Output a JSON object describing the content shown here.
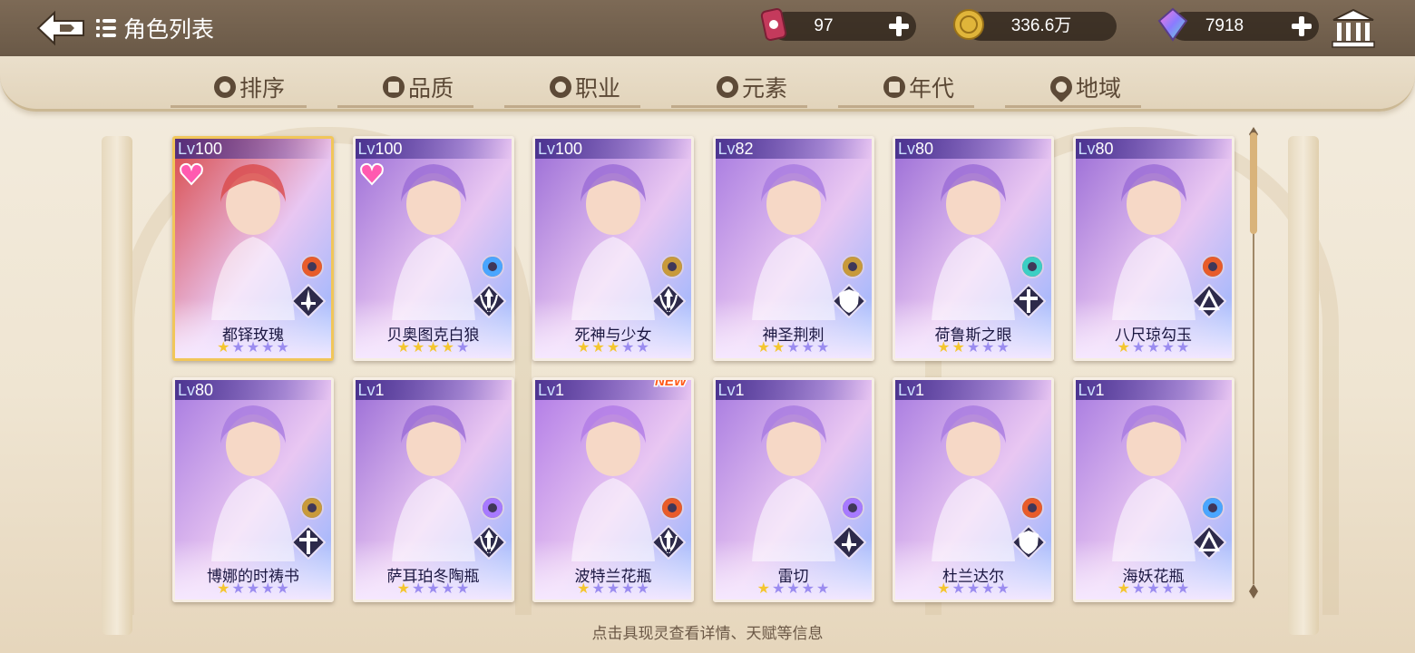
{
  "header": {
    "title": "角色列表",
    "resources": [
      {
        "name": "ticket",
        "value": "97",
        "color": "#c43a5c"
      },
      {
        "name": "gold-coin",
        "value": "336.6万",
        "color": "#e0b53a"
      },
      {
        "name": "rainbow-gem",
        "value": "7918",
        "color": "#b36ee0"
      }
    ]
  },
  "filters": [
    {
      "label": "排序",
      "icon": "sort-icon"
    },
    {
      "label": "品质",
      "icon": "quality-icon"
    },
    {
      "label": "职业",
      "icon": "class-icon"
    },
    {
      "label": "元素",
      "icon": "element-icon"
    },
    {
      "label": "年代",
      "icon": "era-icon"
    },
    {
      "label": "地域",
      "icon": "region-icon"
    }
  ],
  "cards": [
    {
      "lv_label": "Lv",
      "lv": "100",
      "name": "都铎玫瑰",
      "stars": 1,
      "max_stars": 5,
      "heart": true,
      "element": "fire",
      "class": "sword",
      "theme": "#d94a4a",
      "selected": true,
      "new": false
    },
    {
      "lv_label": "Lv",
      "lv": "100",
      "name": "贝奥图克白狼",
      "stars": 4,
      "max_stars": 5,
      "heart": true,
      "element": "water",
      "class": "bow",
      "theme": "#9a6cd6",
      "selected": false,
      "new": false
    },
    {
      "lv_label": "Lv",
      "lv": "100",
      "name": "死神与少女",
      "stars": 3,
      "max_stars": 5,
      "heart": false,
      "element": "earth",
      "class": "bow",
      "theme": "#9a6cd6",
      "selected": false,
      "new": false
    },
    {
      "lv_label": "Lv",
      "lv": "82",
      "name": "神圣荆刺",
      "stars": 2,
      "max_stars": 5,
      "heart": false,
      "element": "earth",
      "class": "shield",
      "theme": "#a77ae0",
      "selected": false,
      "new": false
    },
    {
      "lv_label": "Lv",
      "lv": "80",
      "name": "荷鲁斯之眼",
      "stars": 2,
      "max_stars": 5,
      "heart": false,
      "element": "wind",
      "class": "cross",
      "theme": "#9a6cd6",
      "selected": false,
      "new": false
    },
    {
      "lv_label": "Lv",
      "lv": "80",
      "name": "八尺琼勾玉",
      "stars": 1,
      "max_stars": 5,
      "heart": false,
      "element": "fire",
      "class": "tri",
      "theme": "#9a6cd6",
      "selected": false,
      "new": false
    },
    {
      "lv_label": "Lv",
      "lv": "80",
      "name": "博娜的时祷书",
      "stars": 1,
      "max_stars": 5,
      "heart": false,
      "element": "earth",
      "class": "cross",
      "theme": "#a77ae0",
      "selected": false,
      "new": false
    },
    {
      "lv_label": "Lv",
      "lv": "1",
      "name": "萨耳珀冬陶瓶",
      "stars": 1,
      "max_stars": 5,
      "heart": false,
      "element": "thunder",
      "class": "bow",
      "theme": "#9a6cd6",
      "selected": false,
      "new": false
    },
    {
      "lv_label": "Lv",
      "lv": "1",
      "name": "波特兰花瓶",
      "stars": 1,
      "max_stars": 5,
      "heart": false,
      "element": "fire",
      "class": "bow",
      "theme": "#b07ae6",
      "selected": false,
      "new": true,
      "new_label": "NEW"
    },
    {
      "lv_label": "Lv",
      "lv": "1",
      "name": "雷切",
      "stars": 1,
      "max_stars": 5,
      "heart": false,
      "element": "thunder",
      "class": "sword",
      "theme": "#a77ae0",
      "selected": false,
      "new": false
    },
    {
      "lv_label": "Lv",
      "lv": "1",
      "name": "杜兰达尔",
      "stars": 1,
      "max_stars": 5,
      "heart": false,
      "element": "fire",
      "class": "shield",
      "theme": "#a77ae0",
      "selected": false,
      "new": false
    },
    {
      "lv_label": "Lv",
      "lv": "1",
      "name": "海妖花瓶",
      "stars": 1,
      "max_stars": 5,
      "heart": false,
      "element": "water",
      "class": "tri",
      "theme": "#a77ae0",
      "selected": false,
      "new": false
    }
  ],
  "colors": {
    "element_fire": "#e85c2a",
    "element_water": "#4aa6ff",
    "element_earth": "#c89a3a",
    "element_wind": "#3ccfc4",
    "element_thunder": "#a77aff",
    "star_gold": "#f4c630",
    "star_empty": "#9b8cf0"
  },
  "footer": {
    "hint": "点击具现灵查看详情、天赋等信息"
  }
}
